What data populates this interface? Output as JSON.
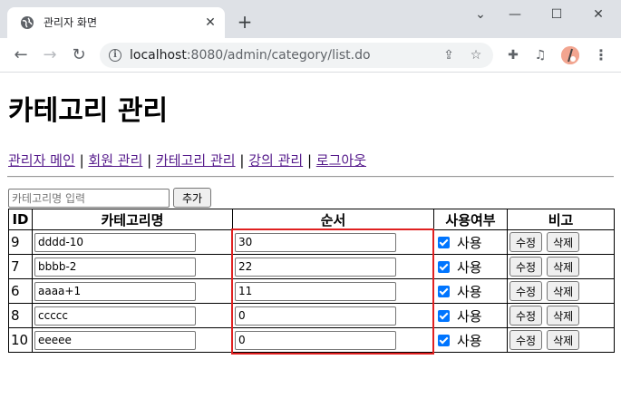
{
  "browser": {
    "tab_title": "관리자 화면",
    "new_tab_label": "+",
    "url_host": "localhost",
    "url_rest": ":8080/admin/category/list.do"
  },
  "page": {
    "title": "카테고리 관리",
    "nav": [
      {
        "label": "관리자 메인"
      },
      {
        "label": "회원 관리"
      },
      {
        "label": "카테고리 관리"
      },
      {
        "label": "강의 관리"
      },
      {
        "label": "로그아웃"
      }
    ],
    "nav_separator": "|",
    "add_placeholder": "카테고리명 입력",
    "add_button": "추가"
  },
  "table": {
    "headers": {
      "id": "ID",
      "name": "카테고리명",
      "order": "순서",
      "use": "사용여부",
      "note": "비고"
    },
    "rows": [
      {
        "id": "9",
        "name": "dddd-10",
        "order": "30",
        "use_label": "사용",
        "checked": true
      },
      {
        "id": "7",
        "name": "bbbb-2",
        "order": "22",
        "use_label": "사용",
        "checked": true
      },
      {
        "id": "6",
        "name": "aaaa+1",
        "order": "11",
        "use_label": "사용",
        "checked": true
      },
      {
        "id": "8",
        "name": "ccccc",
        "order": "0",
        "use_label": "사용",
        "checked": true
      },
      {
        "id": "10",
        "name": "eeeee",
        "order": "0",
        "use_label": "사용",
        "checked": true
      }
    ],
    "edit_button": "수정",
    "delete_button": "삭제"
  },
  "colors": {
    "highlight": "#e02020",
    "link": "#551a8b",
    "checkbox": "#0075ff"
  }
}
